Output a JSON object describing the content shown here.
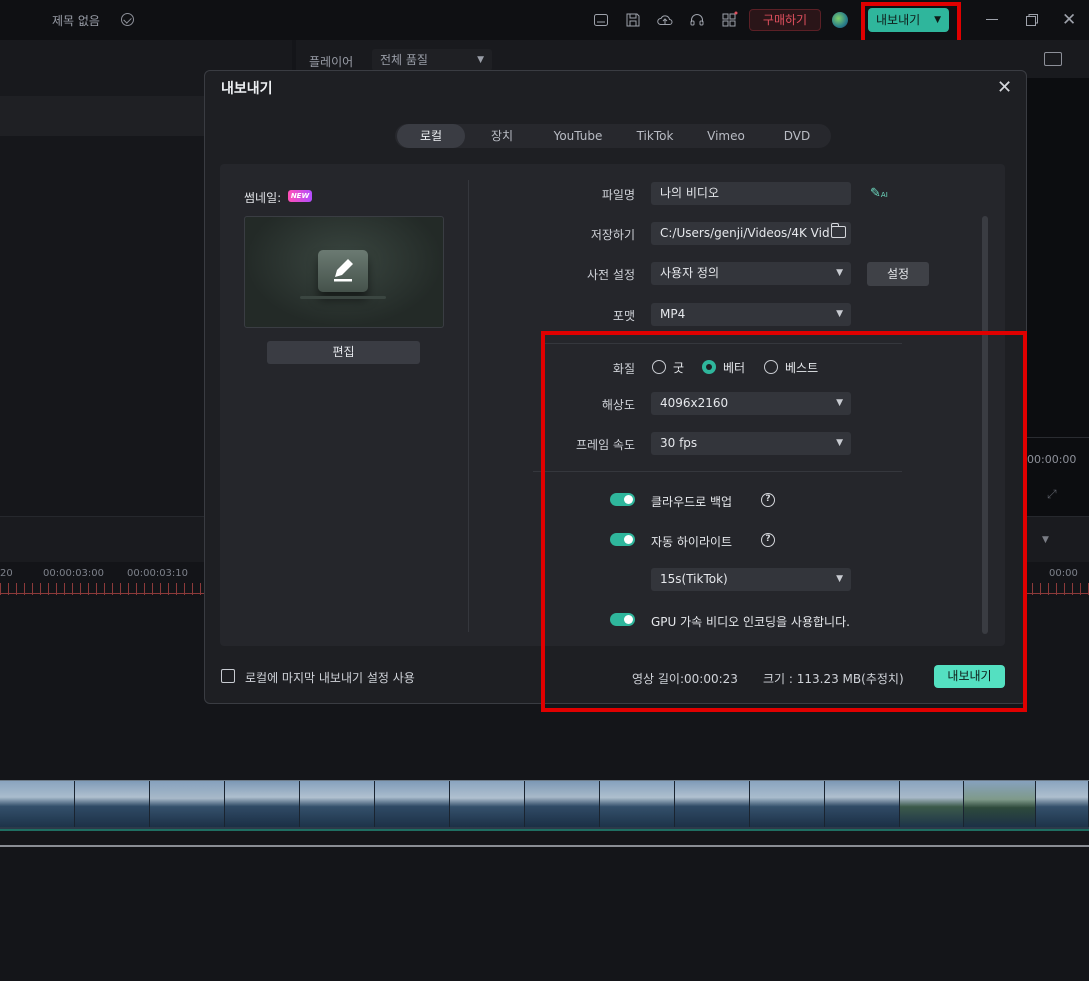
{
  "topbar": {
    "project_title": "제목 없음",
    "buy_label": "구매하기",
    "export_label": "내보내기",
    "colors": {
      "accent": "#2fb69c",
      "buy": "#e0505e",
      "highlight": "#e00000"
    }
  },
  "player": {
    "label": "플레이어",
    "quality": "전체 품질",
    "time": "00:00:00"
  },
  "timeline": {
    "ruler_labels": [
      "20",
      "00:00:03:00",
      "00:00:03:10",
      "00:00"
    ]
  },
  "dialog": {
    "title": "내보내기",
    "tabs": [
      {
        "label": "로컬",
        "active": true
      },
      {
        "label": "장치",
        "active": false
      },
      {
        "label": "YouTube",
        "active": false
      },
      {
        "label": "TikTok",
        "active": false
      },
      {
        "label": "Vimeo",
        "active": false
      },
      {
        "label": "DVD",
        "active": false
      }
    ],
    "thumbnail": {
      "label": "썸네일:",
      "badge": "NEW",
      "edit_label": "편집"
    },
    "fields": {
      "filename": {
        "label": "파일명",
        "value": "나의 비디오",
        "icon_text": "AI"
      },
      "save_to": {
        "label": "저장하기",
        "value": "C:/Users/genji/Videos/4K Vid"
      },
      "preset": {
        "label": "사전 설정",
        "value": "사용자 정의",
        "button": "설정"
      },
      "format": {
        "label": "포맷",
        "value": "MP4"
      },
      "quality": {
        "label": "화질",
        "options": [
          {
            "label": "굿",
            "selected": false
          },
          {
            "label": "베터",
            "selected": true
          },
          {
            "label": "베스트",
            "selected": false
          }
        ]
      },
      "resolution": {
        "label": "해상도",
        "value": "4096x2160"
      },
      "frame_rate": {
        "label": "프레임 속도",
        "value": "30 fps"
      }
    },
    "toggles": [
      {
        "label": "클라우드로 백업",
        "on": true,
        "help": true
      },
      {
        "label": "자동 하이라이트",
        "on": true,
        "help": true
      },
      {
        "label": "GPU 가속 비디오 인코딩을 사용합니다.",
        "on": true,
        "help": false
      }
    ],
    "highlight_length": "15s(TikTok)",
    "footer": {
      "remember_label": "로컬에 마지막 내보내기 설정 사용",
      "duration": "영상 길이:00:00:23",
      "size": "크기 : 113.23 MB(추정치)",
      "export_label": "내보내기"
    }
  }
}
